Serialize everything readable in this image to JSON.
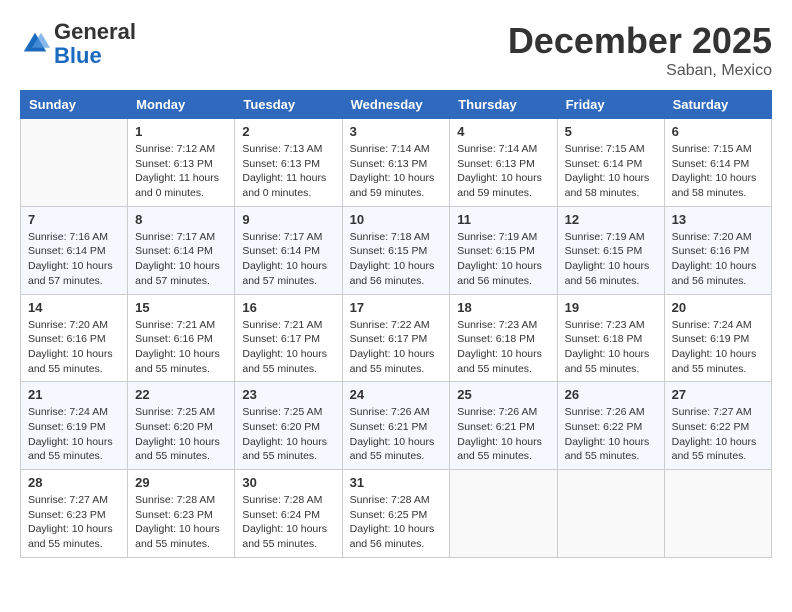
{
  "header": {
    "logo_general": "General",
    "logo_blue": "Blue",
    "month_title": "December 2025",
    "location": "Saban, Mexico"
  },
  "weekdays": [
    "Sunday",
    "Monday",
    "Tuesday",
    "Wednesday",
    "Thursday",
    "Friday",
    "Saturday"
  ],
  "weeks": [
    [
      {
        "day": "",
        "sunrise": "",
        "sunset": "",
        "daylight": "",
        "empty": true
      },
      {
        "day": "1",
        "sunrise": "Sunrise: 7:12 AM",
        "sunset": "Sunset: 6:13 PM",
        "daylight": "Daylight: 11 hours and 0 minutes."
      },
      {
        "day": "2",
        "sunrise": "Sunrise: 7:13 AM",
        "sunset": "Sunset: 6:13 PM",
        "daylight": "Daylight: 11 hours and 0 minutes."
      },
      {
        "day": "3",
        "sunrise": "Sunrise: 7:14 AM",
        "sunset": "Sunset: 6:13 PM",
        "daylight": "Daylight: 10 hours and 59 minutes."
      },
      {
        "day": "4",
        "sunrise": "Sunrise: 7:14 AM",
        "sunset": "Sunset: 6:13 PM",
        "daylight": "Daylight: 10 hours and 59 minutes."
      },
      {
        "day": "5",
        "sunrise": "Sunrise: 7:15 AM",
        "sunset": "Sunset: 6:14 PM",
        "daylight": "Daylight: 10 hours and 58 minutes."
      },
      {
        "day": "6",
        "sunrise": "Sunrise: 7:15 AM",
        "sunset": "Sunset: 6:14 PM",
        "daylight": "Daylight: 10 hours and 58 minutes."
      }
    ],
    [
      {
        "day": "7",
        "sunrise": "Sunrise: 7:16 AM",
        "sunset": "Sunset: 6:14 PM",
        "daylight": "Daylight: 10 hours and 57 minutes."
      },
      {
        "day": "8",
        "sunrise": "Sunrise: 7:17 AM",
        "sunset": "Sunset: 6:14 PM",
        "daylight": "Daylight: 10 hours and 57 minutes."
      },
      {
        "day": "9",
        "sunrise": "Sunrise: 7:17 AM",
        "sunset": "Sunset: 6:14 PM",
        "daylight": "Daylight: 10 hours and 57 minutes."
      },
      {
        "day": "10",
        "sunrise": "Sunrise: 7:18 AM",
        "sunset": "Sunset: 6:15 PM",
        "daylight": "Daylight: 10 hours and 56 minutes."
      },
      {
        "day": "11",
        "sunrise": "Sunrise: 7:19 AM",
        "sunset": "Sunset: 6:15 PM",
        "daylight": "Daylight: 10 hours and 56 minutes."
      },
      {
        "day": "12",
        "sunrise": "Sunrise: 7:19 AM",
        "sunset": "Sunset: 6:15 PM",
        "daylight": "Daylight: 10 hours and 56 minutes."
      },
      {
        "day": "13",
        "sunrise": "Sunrise: 7:20 AM",
        "sunset": "Sunset: 6:16 PM",
        "daylight": "Daylight: 10 hours and 56 minutes."
      }
    ],
    [
      {
        "day": "14",
        "sunrise": "Sunrise: 7:20 AM",
        "sunset": "Sunset: 6:16 PM",
        "daylight": "Daylight: 10 hours and 55 minutes."
      },
      {
        "day": "15",
        "sunrise": "Sunrise: 7:21 AM",
        "sunset": "Sunset: 6:16 PM",
        "daylight": "Daylight: 10 hours and 55 minutes."
      },
      {
        "day": "16",
        "sunrise": "Sunrise: 7:21 AM",
        "sunset": "Sunset: 6:17 PM",
        "daylight": "Daylight: 10 hours and 55 minutes."
      },
      {
        "day": "17",
        "sunrise": "Sunrise: 7:22 AM",
        "sunset": "Sunset: 6:17 PM",
        "daylight": "Daylight: 10 hours and 55 minutes."
      },
      {
        "day": "18",
        "sunrise": "Sunrise: 7:23 AM",
        "sunset": "Sunset: 6:18 PM",
        "daylight": "Daylight: 10 hours and 55 minutes."
      },
      {
        "day": "19",
        "sunrise": "Sunrise: 7:23 AM",
        "sunset": "Sunset: 6:18 PM",
        "daylight": "Daylight: 10 hours and 55 minutes."
      },
      {
        "day": "20",
        "sunrise": "Sunrise: 7:24 AM",
        "sunset": "Sunset: 6:19 PM",
        "daylight": "Daylight: 10 hours and 55 minutes."
      }
    ],
    [
      {
        "day": "21",
        "sunrise": "Sunrise: 7:24 AM",
        "sunset": "Sunset: 6:19 PM",
        "daylight": "Daylight: 10 hours and 55 minutes."
      },
      {
        "day": "22",
        "sunrise": "Sunrise: 7:25 AM",
        "sunset": "Sunset: 6:20 PM",
        "daylight": "Daylight: 10 hours and 55 minutes."
      },
      {
        "day": "23",
        "sunrise": "Sunrise: 7:25 AM",
        "sunset": "Sunset: 6:20 PM",
        "daylight": "Daylight: 10 hours and 55 minutes."
      },
      {
        "day": "24",
        "sunrise": "Sunrise: 7:26 AM",
        "sunset": "Sunset: 6:21 PM",
        "daylight": "Daylight: 10 hours and 55 minutes."
      },
      {
        "day": "25",
        "sunrise": "Sunrise: 7:26 AM",
        "sunset": "Sunset: 6:21 PM",
        "daylight": "Daylight: 10 hours and 55 minutes."
      },
      {
        "day": "26",
        "sunrise": "Sunrise: 7:26 AM",
        "sunset": "Sunset: 6:22 PM",
        "daylight": "Daylight: 10 hours and 55 minutes."
      },
      {
        "day": "27",
        "sunrise": "Sunrise: 7:27 AM",
        "sunset": "Sunset: 6:22 PM",
        "daylight": "Daylight: 10 hours and 55 minutes."
      }
    ],
    [
      {
        "day": "28",
        "sunrise": "Sunrise: 7:27 AM",
        "sunset": "Sunset: 6:23 PM",
        "daylight": "Daylight: 10 hours and 55 minutes."
      },
      {
        "day": "29",
        "sunrise": "Sunrise: 7:28 AM",
        "sunset": "Sunset: 6:23 PM",
        "daylight": "Daylight: 10 hours and 55 minutes."
      },
      {
        "day": "30",
        "sunrise": "Sunrise: 7:28 AM",
        "sunset": "Sunset: 6:24 PM",
        "daylight": "Daylight: 10 hours and 55 minutes."
      },
      {
        "day": "31",
        "sunrise": "Sunrise: 7:28 AM",
        "sunset": "Sunset: 6:25 PM",
        "daylight": "Daylight: 10 hours and 56 minutes."
      },
      {
        "day": "",
        "sunrise": "",
        "sunset": "",
        "daylight": "",
        "empty": true
      },
      {
        "day": "",
        "sunrise": "",
        "sunset": "",
        "daylight": "",
        "empty": true
      },
      {
        "day": "",
        "sunrise": "",
        "sunset": "",
        "daylight": "",
        "empty": true
      }
    ]
  ]
}
